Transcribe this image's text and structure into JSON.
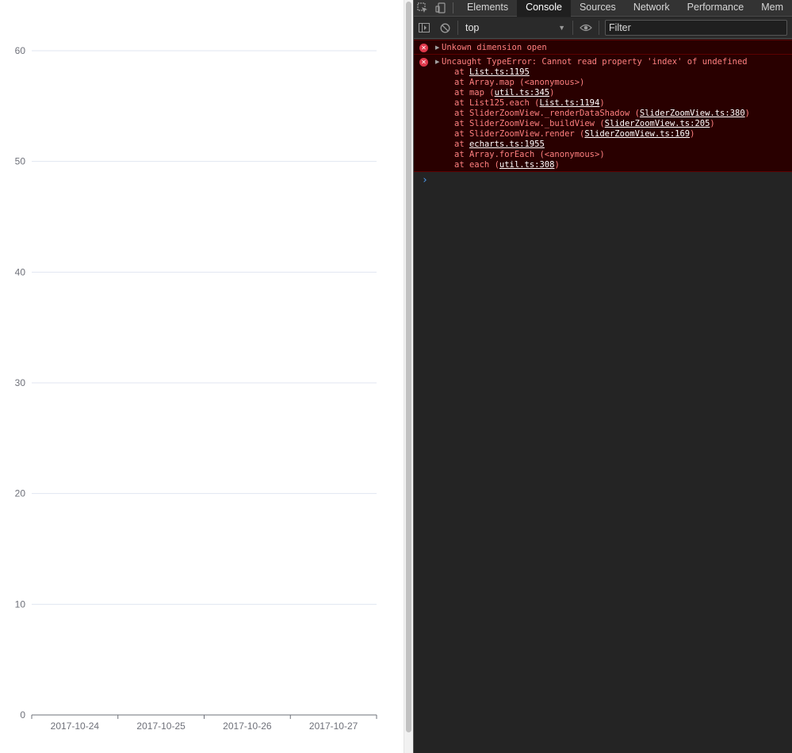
{
  "chart_data": {
    "type": "bar",
    "categories": [
      "2017-10-24",
      "2017-10-25",
      "2017-10-26",
      "2017-10-27"
    ],
    "series": [],
    "y_ticks": [
      "0",
      "10",
      "20",
      "30",
      "40",
      "50",
      "60"
    ],
    "ylim": [
      0,
      60
    ],
    "grid": true,
    "title": "",
    "xlabel": "",
    "ylabel": ""
  },
  "devtools": {
    "tabs": [
      {
        "label": "Elements",
        "active": false
      },
      {
        "label": "Console",
        "active": true
      },
      {
        "label": "Sources",
        "active": false
      },
      {
        "label": "Network",
        "active": false
      },
      {
        "label": "Performance",
        "active": false
      },
      {
        "label": "Mem",
        "active": false
      }
    ],
    "toolbar": {
      "context": "top",
      "filter_placeholder": "Filter"
    },
    "icons": {
      "inspect": "inspect-element-icon",
      "device": "device-toolbar-icon",
      "sidebar": "sidebar-toggle-icon",
      "clear": "clear-console-icon",
      "eye": "live-expression-icon",
      "error": "error-icon"
    },
    "colors": {
      "error_bg": "#290000",
      "error_text": "#ff8080",
      "error_icon": "#e0394c",
      "prompt": "#4d9bf0"
    },
    "messages": [
      {
        "text": "Unkown dimension open"
      },
      {
        "text": "Uncaught TypeError: Cannot read property 'index' of undefined",
        "stack": [
          {
            "prefix": "at ",
            "link": "List.ts:1195",
            "suffix": ""
          },
          {
            "prefix": "at Array.map (<anonymous>)",
            "link": "",
            "suffix": ""
          },
          {
            "prefix": "at map (",
            "link": "util.ts:345",
            "suffix": ")"
          },
          {
            "prefix": "at List125.each (",
            "link": "List.ts:1194",
            "suffix": ")"
          },
          {
            "prefix": "at SliderZoomView._renderDataShadow (",
            "link": "SliderZoomView.ts:380",
            "suffix": ")"
          },
          {
            "prefix": "at SliderZoomView._buildView (",
            "link": "SliderZoomView.ts:205",
            "suffix": ")"
          },
          {
            "prefix": "at SliderZoomView.render (",
            "link": "SliderZoomView.ts:169",
            "suffix": ")"
          },
          {
            "prefix": "at ",
            "link": "echarts.ts:1955",
            "suffix": ""
          },
          {
            "prefix": "at Array.forEach (<anonymous>)",
            "link": "",
            "suffix": ""
          },
          {
            "prefix": "at each (",
            "link": "util.ts:308",
            "suffix": ")"
          }
        ]
      }
    ],
    "prompt": "›"
  }
}
